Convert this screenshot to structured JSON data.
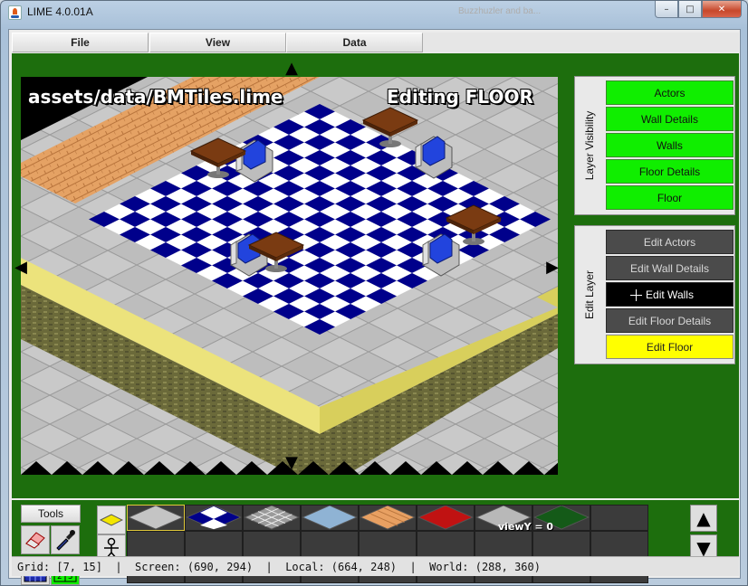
{
  "window": {
    "title": "LIME 4.0.01A",
    "background_tab_ghost": "Buzzhuzler and ba...",
    "minimize_glyph": "–",
    "maximize_glyph": "□",
    "close_glyph": "✕"
  },
  "menu": [
    "File",
    "View",
    "Data"
  ],
  "viewport": {
    "file_path": "assets/data/BMTiles.lime",
    "editing_label": "Editing FLOOR",
    "view_y": "viewY = 0",
    "scroll_up_glyph": "▲",
    "scroll_down_glyph": "▼",
    "scroll_left_glyph": "◀",
    "scroll_right_glyph": "▶"
  },
  "layer_visibility": {
    "title": "Layer Visibility",
    "items": [
      "Actors",
      "Wall Details",
      "Walls",
      "Floor Details",
      "Floor"
    ]
  },
  "edit_layer": {
    "title": "Edit Layer",
    "items": [
      "Edit Actors",
      "Edit Wall Details",
      "Edit Walls",
      "Edit Floor Details",
      "Edit Floor"
    ],
    "selected": "Edit Floor",
    "highlighted": "Edit Walls"
  },
  "tools": {
    "label": "Tools",
    "buttons": [
      "eraser-icon",
      "eyedropper-icon",
      "grid-icon",
      "number-grid-icon"
    ],
    "number_grid_digits": [
      "0",
      "1",
      "2",
      "3"
    ],
    "palette_scroll_up": "▲",
    "palette_scroll_down": "▼"
  },
  "palette": {
    "tiles": [
      "gray-tile",
      "blue-checker-tile",
      "grate-tile",
      "glass-tile",
      "wood-tile",
      "red-carpet-tile",
      "concrete-tile",
      "grass-tile"
    ],
    "selected_index": 0
  },
  "status": {
    "text": "Grid: [7, 15]  |  Screen: (690, 294)  |  Local: (664, 248)  |  World: (288, 360)"
  },
  "colors": {
    "green_bg": "#1d6e0d",
    "visible_green": "#10ee00",
    "edit_dark": "#4b4b4b",
    "edit_selected": "#ffff00",
    "checker_blue": "#00008b"
  }
}
